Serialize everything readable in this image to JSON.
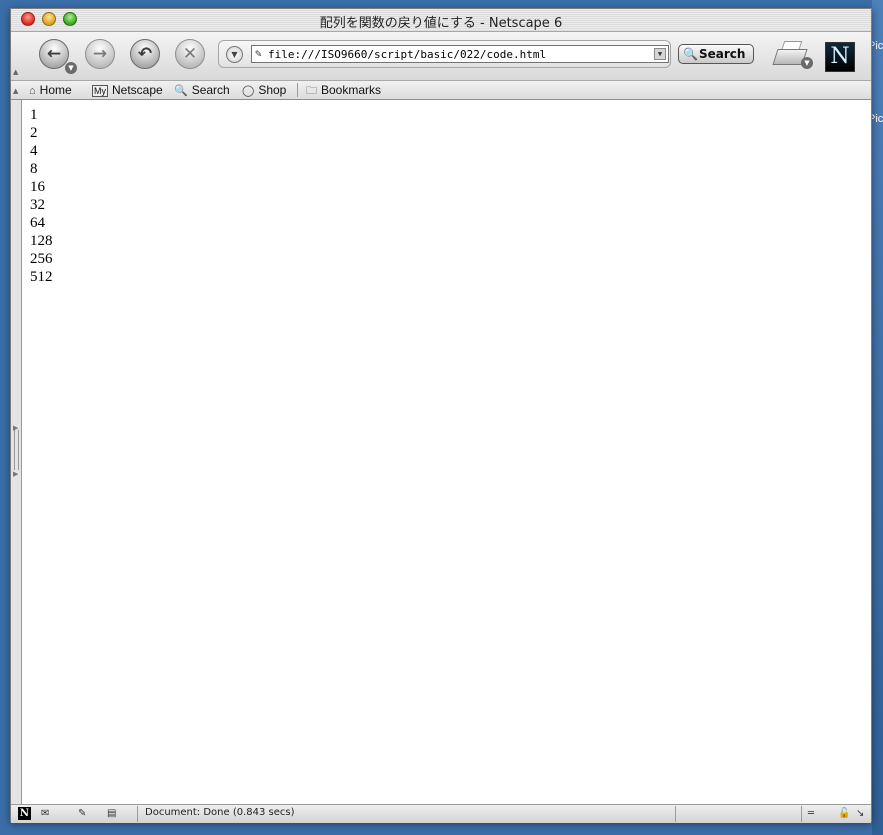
{
  "window": {
    "title": "配列を関数の戻り値にする - Netscape 6"
  },
  "desktop": {
    "label_top": "Pic",
    "label_second": "Pic"
  },
  "navigation": {
    "url": "file:///ISO9660/script/basic/022/code.html",
    "search_label": "Search"
  },
  "bookmarks": {
    "items": [
      {
        "label": "Home",
        "icon": "home-icon"
      },
      {
        "label": "Netscape",
        "icon": "my-netscape-icon",
        "badge": "My"
      },
      {
        "label": "Search",
        "icon": "magnifier-icon"
      },
      {
        "label": "Shop",
        "icon": "shop-icon"
      },
      {
        "label": "Bookmarks",
        "icon": "folder-icon"
      }
    ]
  },
  "content": {
    "lines": [
      "1",
      "2",
      "4",
      "8",
      "16",
      "32",
      "64",
      "128",
      "256",
      "512"
    ]
  },
  "status": {
    "text": "Document: Done (0.843 secs)"
  },
  "colors": {
    "desktop": "#3b6ea8",
    "close": "#d8281a",
    "minimize": "#d9a21a",
    "zoom": "#37a320"
  }
}
